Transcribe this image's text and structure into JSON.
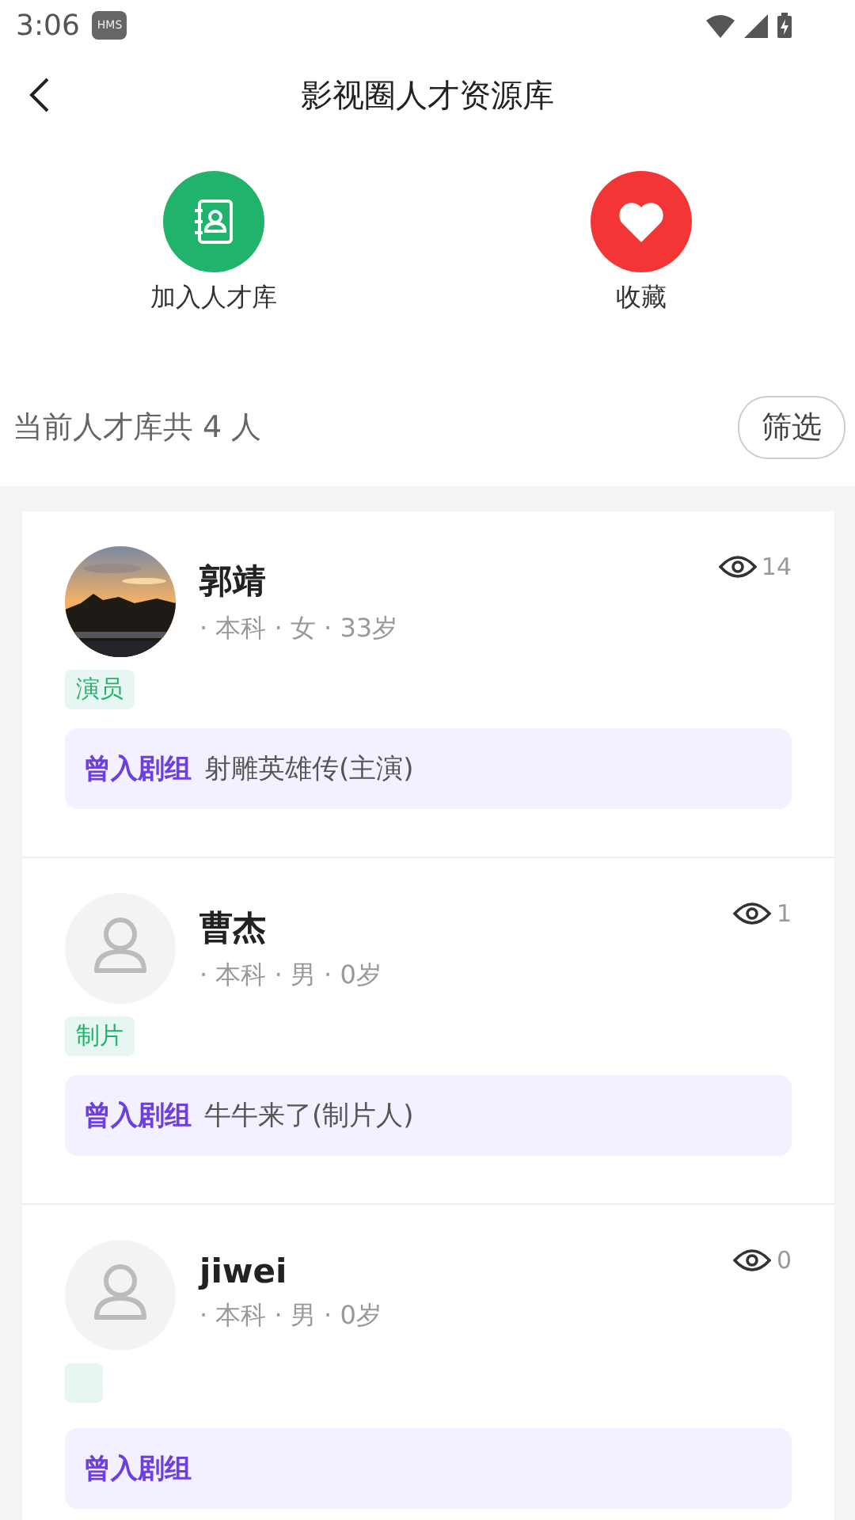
{
  "status_bar": {
    "time": "3:06",
    "badge": "HMS"
  },
  "header": {
    "title": "影视圈人才资源库"
  },
  "actions": [
    {
      "label": "加入人才库",
      "kind": "join"
    },
    {
      "label": "收藏",
      "kind": "favorite"
    }
  ],
  "summary": {
    "text": "当前人才库共 4 人",
    "filter_button": "筛选"
  },
  "people": [
    {
      "name": "郭靖",
      "details": "· 本科 · 女 · 33岁",
      "views": "14",
      "tag": {
        "kind": "label",
        "label": "演员"
      },
      "crew_label": "曾入剧组",
      "crew": "射雕英雄传(主演)"
    },
    {
      "name": "曹杰",
      "avatar": {
        "kind": "placeholder"
      },
      "details": "· 本科 · 男 · 0岁",
      "views": "1",
      "tag": {
        "kind": "label",
        "label": "制片"
      },
      "crew_label": "曾入剧组",
      "crew": "牛牛来了(制片人)"
    },
    {
      "name": "jiwei",
      "avatar": {
        "kind": "placeholder"
      },
      "details": "· 本科 · 男 · 0岁",
      "views": "0",
      "tag": {
        "kind": "blank"
      },
      "crew_label": "曾入剧组"
    }
  ]
}
